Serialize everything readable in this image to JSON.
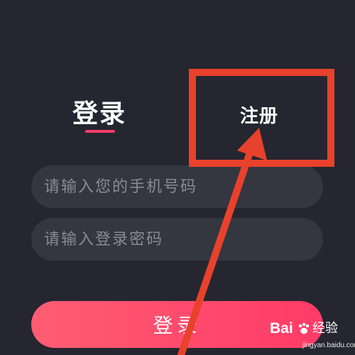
{
  "tabs": {
    "login_label": "登录",
    "register_label": "注册"
  },
  "form": {
    "phone_placeholder": "请输入您的手机号码",
    "password_placeholder": "请输入登录密码",
    "submit_label": "登录"
  },
  "watermark": {
    "logo_text": "Bai",
    "logo_text_suffix": "",
    "name": "经验",
    "url": "jingyan.baidu.com"
  },
  "colors": {
    "background": "#252630",
    "field_background": "#343640",
    "accent": "#ff3c6a",
    "annotation": "#e8412c"
  },
  "icons": {
    "annotation_arrow": "red-arrow-icon",
    "watermark_paw": "baidu-paw-icon"
  }
}
